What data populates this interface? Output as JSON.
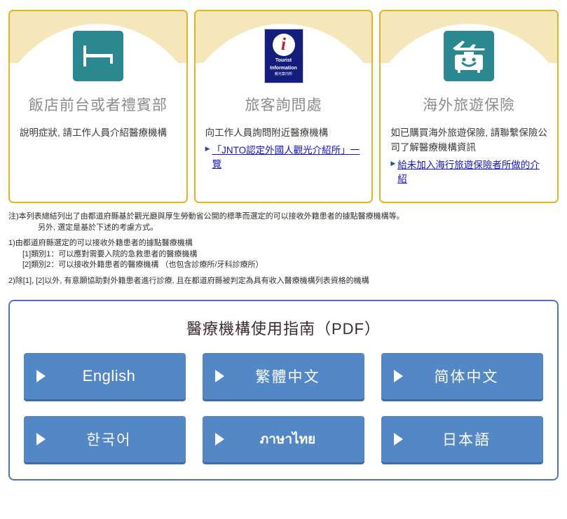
{
  "cards": [
    {
      "icon": "hotel-bed-icon",
      "title": "飯店前台或者禮賓部",
      "body": "說明症狀, 請工作人員介紹醫療機構",
      "link": null
    },
    {
      "icon": "tourist-information-icon",
      "icon_text_line1": "Tourist",
      "icon_text_line2": "Information",
      "icon_text_line3": "観光案内所",
      "icon_letter": "i",
      "title": "旅客詢問處",
      "body": "向工作人員詢問附近醫療機構",
      "link": "「JNTO認定外國人觀光介紹所」一覽"
    },
    {
      "icon": "travel-insurance-suitcase-plane-icon",
      "title": "海外旅遊保險",
      "body": "如已購買海外旅遊保險, 請聯繫保險公司了解醫療機構資訊",
      "link": "給未加入海行旅遊保險者所做的介紹"
    }
  ],
  "notes": {
    "line1": "注)本列表總結列出了由都道府縣基於觀光廳與厚生勞動省公開的標準而選定的可以接收外籍患者的據點醫療機構等。",
    "line2": "另外, 選定是基於下述的考慮方式。",
    "line3": "1)由都道府縣選定的可以接收外籍患者的據點醫療機構",
    "line4": "[1]類別1：可以應對需要入院的急救患者的醫療機構",
    "line5": "[2]類別2：可以接收外籍患者的醫療機構 （也包含診療所/牙科診療所）",
    "line6": "2)除[1], [2]以外, 有意願協助對外籍患者進行診療, 且在都道府縣被判定為具有收入醫療機構列表資格的機構"
  },
  "pdf_section": {
    "title": "醫療機構使用指南（PDF）",
    "buttons": [
      {
        "label": "English",
        "style": "latin"
      },
      {
        "label": "繁體中文",
        "style": "cjk"
      },
      {
        "label": "简体中文",
        "style": "cjk"
      },
      {
        "label": "한국어",
        "style": "cjk"
      },
      {
        "label": "ภาษาไทย",
        "style": "thai"
      },
      {
        "label": "日本語",
        "style": "cjk"
      }
    ]
  },
  "colors": {
    "card_border": "#e2b426",
    "card_band": "#f6e7bb",
    "icon_teal": "#2a8891",
    "panel_border": "#4a78b8",
    "button_blue": "#5387c6",
    "link_blue": "#1414c8"
  }
}
